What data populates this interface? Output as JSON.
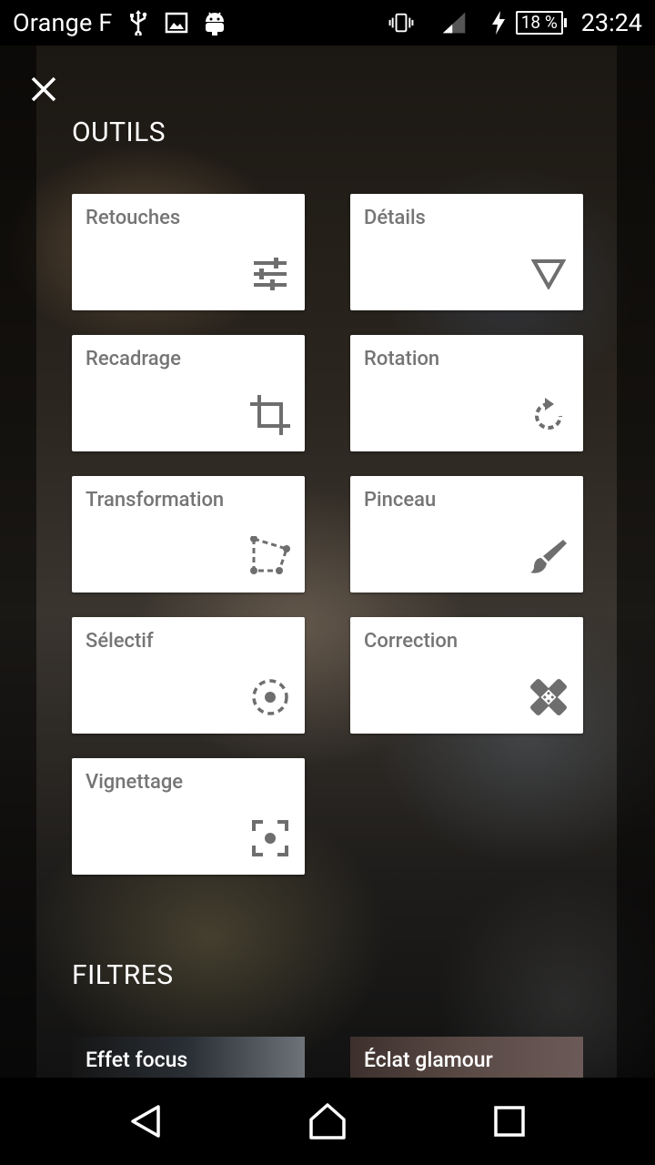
{
  "status_bar": {
    "carrier": "Orange F",
    "battery_percent": "18 %",
    "time": "23:24",
    "icons": [
      "usb-icon",
      "image-icon",
      "android-icon",
      "vibrate-icon",
      "signal-icon",
      "charging-icon"
    ]
  },
  "tools": {
    "section_title": "OUTILS",
    "items": [
      {
        "label": "Retouches",
        "icon": "tune-icon"
      },
      {
        "label": "Détails",
        "icon": "details-triangle-icon"
      },
      {
        "label": "Recadrage",
        "icon": "crop-icon"
      },
      {
        "label": "Rotation",
        "icon": "rotate-icon"
      },
      {
        "label": "Transformation",
        "icon": "perspective-icon"
      },
      {
        "label": "Pinceau",
        "icon": "brush-icon"
      },
      {
        "label": "Sélectif",
        "icon": "selective-icon"
      },
      {
        "label": "Correction",
        "icon": "healing-icon"
      },
      {
        "label": "Vignettage",
        "icon": "vignette-icon"
      }
    ]
  },
  "filters": {
    "section_title": "FILTRES",
    "items": [
      {
        "label": "Effet focus"
      },
      {
        "label": "Éclat glamour"
      }
    ]
  },
  "colors": {
    "card_background": "#ffffff",
    "card_label": "#757575",
    "icon": "#6e6e6e",
    "system_bars": "#000000"
  }
}
